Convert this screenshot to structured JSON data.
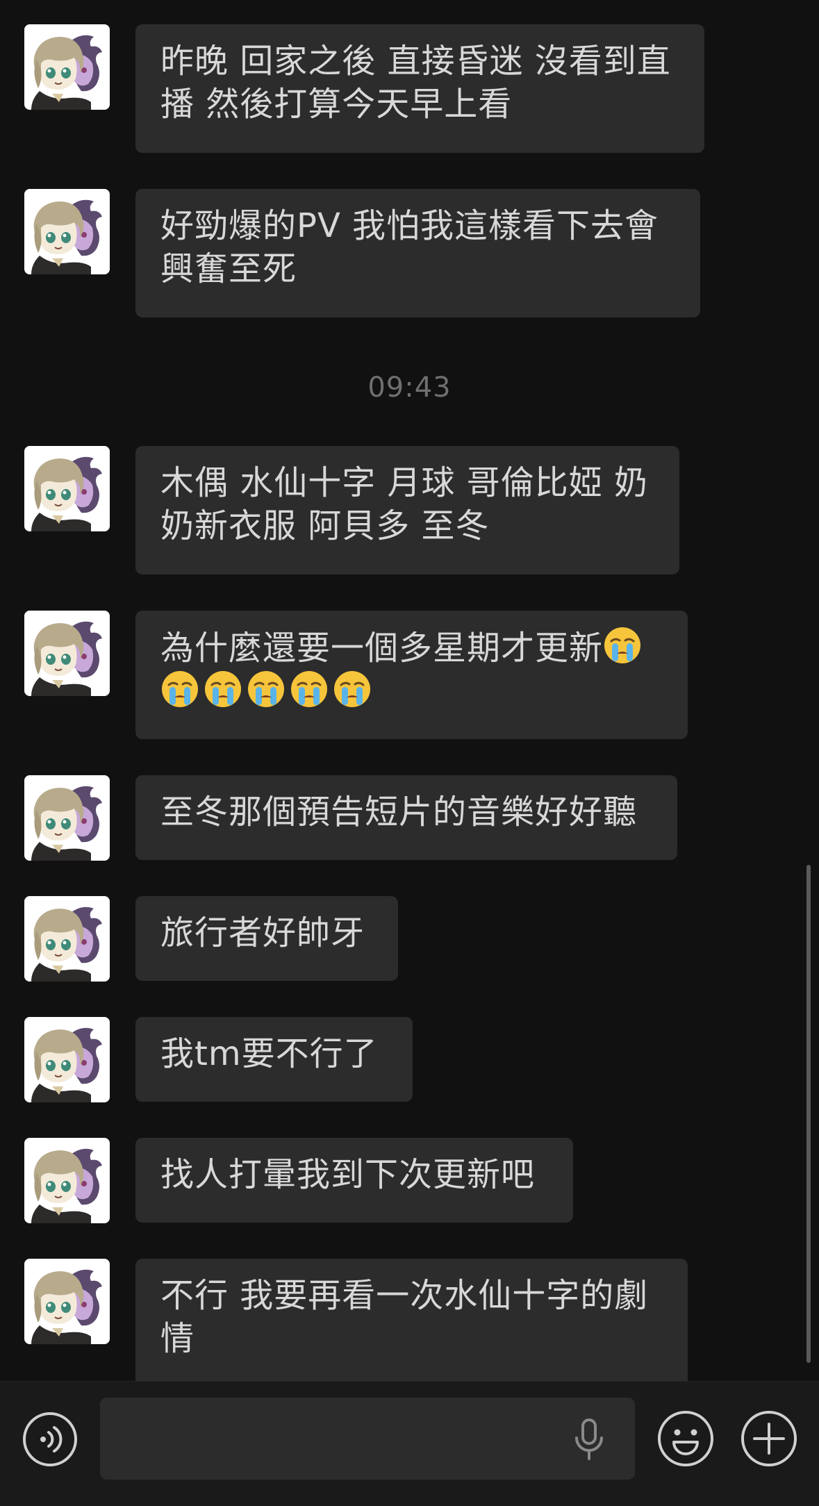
{
  "messages": [
    {
      "text": "昨晚 回家之後 直接昏迷 沒看到直播 然後打算今天早上看"
    },
    {
      "text": "好勁爆的PV 我怕我這樣看下去會興奮至死"
    },
    {
      "text": "木偶 水仙十字 月球 哥倫比婭 奶奶新衣服 阿貝多 至冬"
    },
    {
      "text": "為什麼還要一個多星期才更新"
    },
    {
      "text": "至冬那個預告短片的音樂好好聽"
    },
    {
      "text": "旅行者好帥牙"
    },
    {
      "text": "我tm要不行了"
    },
    {
      "text": "找人打暈我到下次更新吧"
    },
    {
      "text": "不行 我要再看一次水仙十字的劇情"
    }
  ],
  "timestamp": "09:43",
  "emoji_count": 6,
  "icons": {
    "avatar": "chibi-character-avatar-icon",
    "crying_emoji": "crying-face-emoji",
    "voice": "voice-input-icon",
    "mic": "microphone-icon",
    "emoji": "emoji-face-icon",
    "plus": "plus-icon"
  },
  "colors": {
    "background": "#111111",
    "bubble": "#2c2c2c",
    "text": "#d8d8d8",
    "timestamp": "#6f6f6f"
  }
}
